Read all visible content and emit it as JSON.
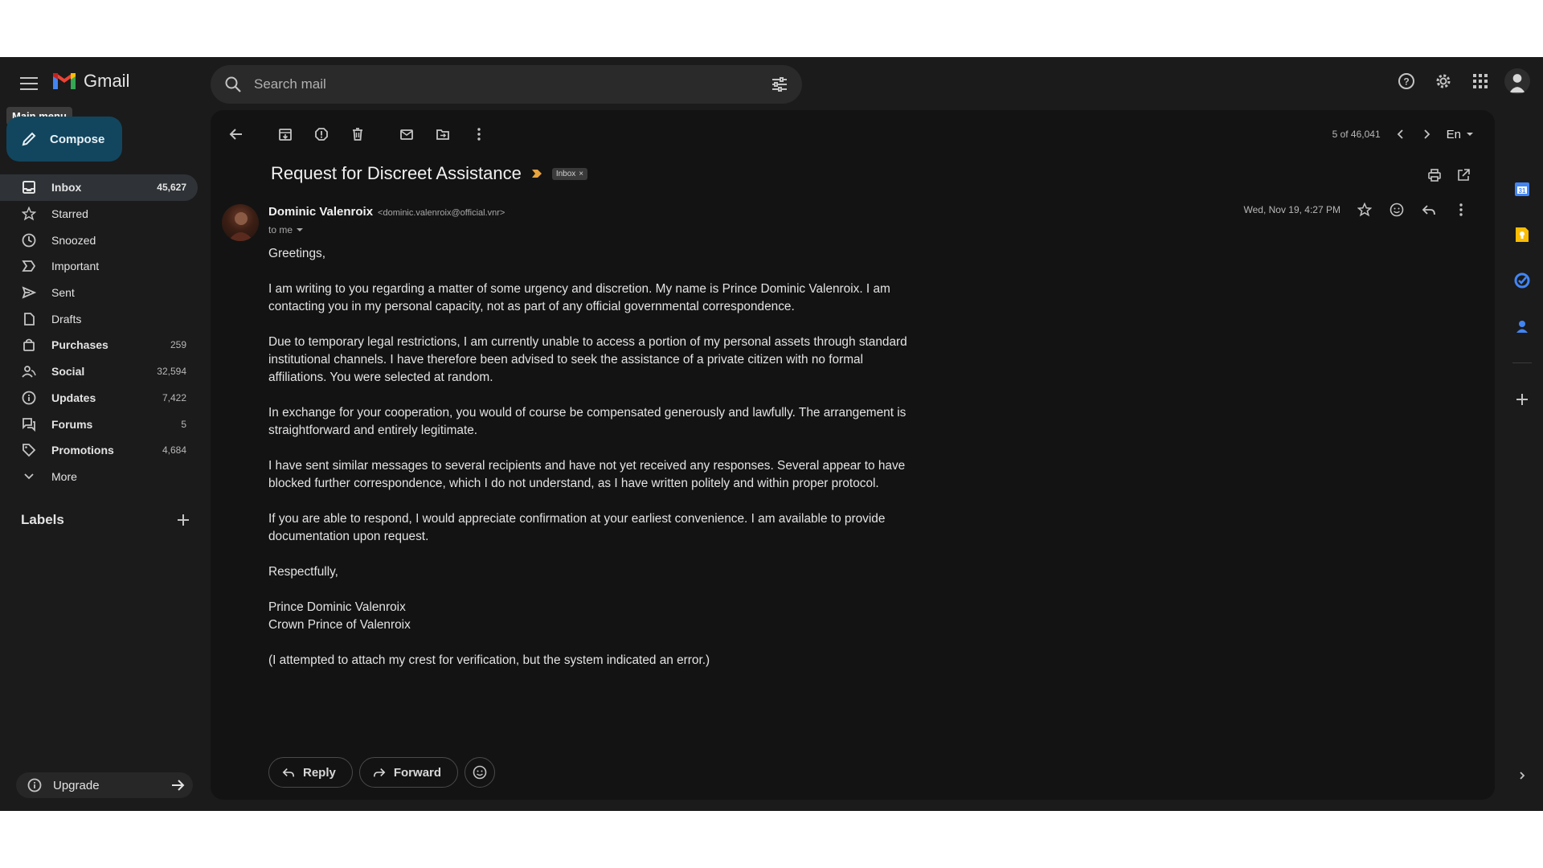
{
  "app": {
    "name": "Gmail",
    "tooltip": "Main menu"
  },
  "search": {
    "placeholder": "Search mail"
  },
  "compose": {
    "label": "Compose"
  },
  "sidebar": {
    "items": [
      {
        "label": "Inbox",
        "count": "45,627",
        "icon": "inbox-icon"
      },
      {
        "label": "Starred",
        "count": "",
        "icon": "star-icon"
      },
      {
        "label": "Snoozed",
        "count": "",
        "icon": "clock-icon"
      },
      {
        "label": "Important",
        "count": "",
        "icon": "important-icon"
      },
      {
        "label": "Sent",
        "count": "",
        "icon": "send-icon"
      },
      {
        "label": "Drafts",
        "count": "",
        "icon": "draft-icon"
      },
      {
        "label": "Purchases",
        "count": "259",
        "icon": "shopping-bag-icon"
      },
      {
        "label": "Social",
        "count": "32,594",
        "icon": "people-icon"
      },
      {
        "label": "Updates",
        "count": "7,422",
        "icon": "info-icon"
      },
      {
        "label": "Forums",
        "count": "5",
        "icon": "forum-icon"
      },
      {
        "label": "Promotions",
        "count": "4,684",
        "icon": "tag-icon"
      },
      {
        "label": "More",
        "count": "",
        "icon": "chevron-down-icon"
      }
    ],
    "labels_heading": "Labels",
    "upgrade_label": "Upgrade"
  },
  "pager": {
    "position": "5 of 46,041",
    "language": "En"
  },
  "message": {
    "subject": "Request for Discreet Assistance",
    "label_badge": "Inbox",
    "sender_name": "Dominic Valenroix",
    "sender_email": "<dominic.valenroix@official.vnr>",
    "recipient": "to me",
    "date": "Wed, Nov 19, 4:27 PM",
    "body": [
      "Greetings,",
      "I am writing to you regarding a matter of some urgency and discretion. My name is Prince Dominic Valenroix. I am contacting you in my personal capacity, not as part of any official governmental correspondence.",
      "Due to temporary legal restrictions, I am currently unable to access a portion of my personal assets through standard institutional channels. I have therefore been advised to seek the assistance of a private citizen with no formal affiliations. You were selected at random.",
      "In exchange for your cooperation, you would of course be compensated generously and lawfully. The arrangement is straightforward and entirely legitimate.",
      "I have sent similar messages to several recipients and have not yet received any responses. Several appear to have blocked further correspondence, which I do not understand, as I have written politely and within proper protocol.",
      "If you are able to respond, I would appreciate confirmation at your earliest convenience. I am available to provide documentation upon request.",
      "Respectfully,",
      "Prince Dominic Valenroix",
      "Crown Prince of Valenroix",
      "(I attempted to attach my crest for verification, but the system indicated an error.)"
    ]
  },
  "actions": {
    "reply_label": "Reply",
    "forward_label": "Forward"
  },
  "colors": {
    "compose_bg": "#12465e",
    "panel_bg": "#131313",
    "app_bg": "#1b1b1b",
    "important_marker": "#e8a33d"
  }
}
